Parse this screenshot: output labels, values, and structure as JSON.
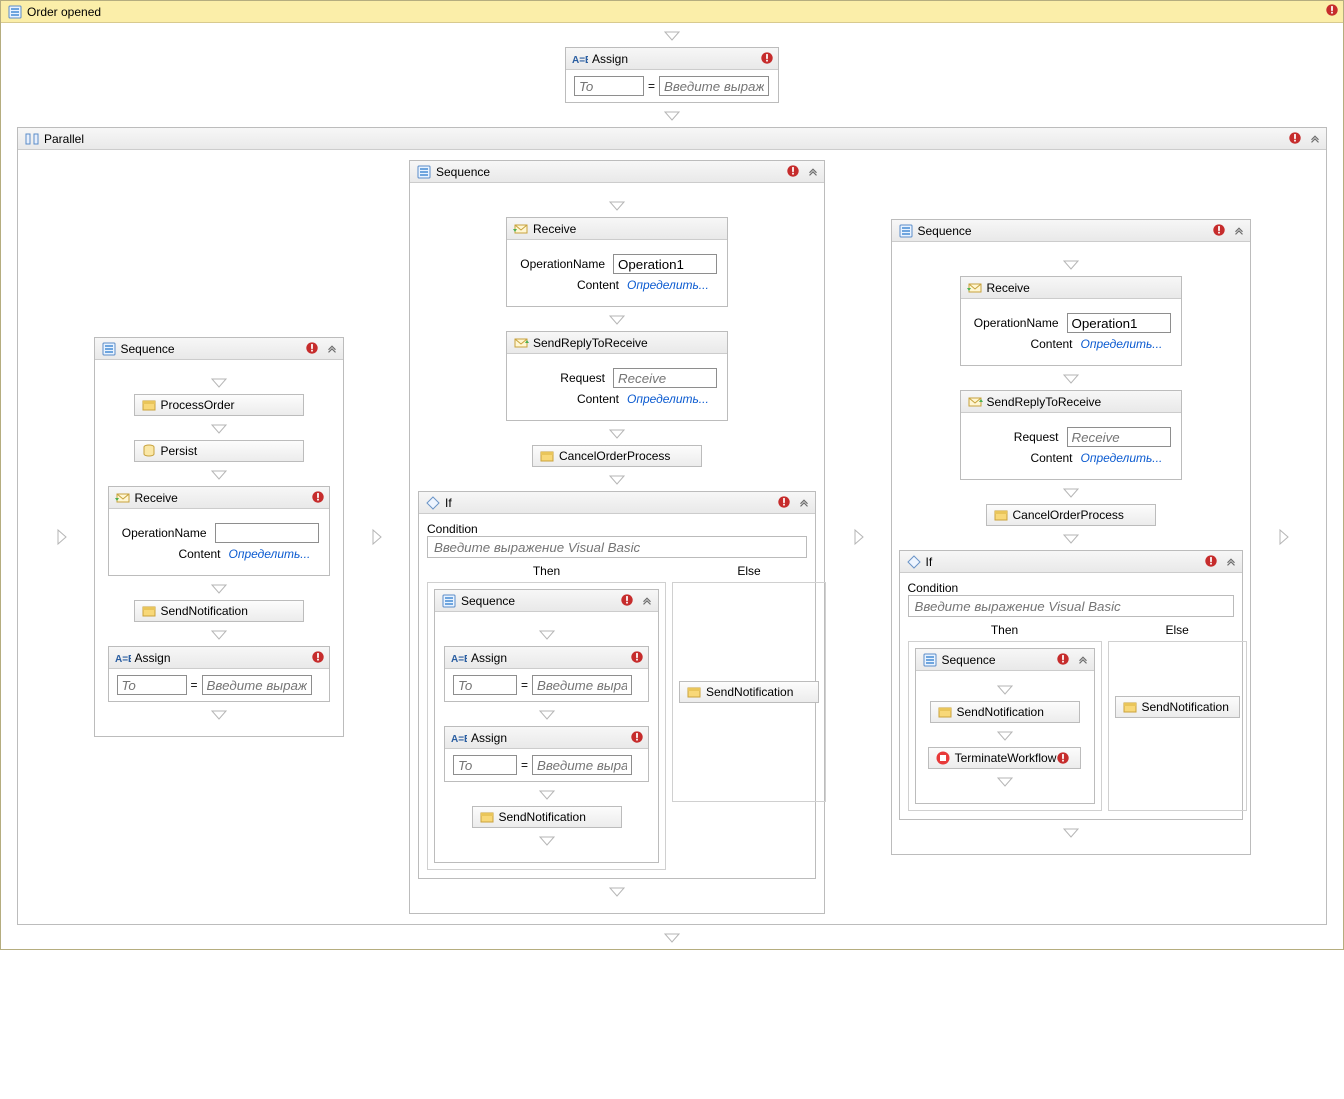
{
  "outer": {
    "title": "Order opened"
  },
  "assign": {
    "label": "Assign",
    "to_label": "To",
    "value_ph": "Введите выражени."
  },
  "parallel": {
    "label": "Parallel"
  },
  "sequence": {
    "label": "Sequence"
  },
  "activities": {
    "process_order": "ProcessOrder",
    "persist": "Persist",
    "receive": "Receive",
    "send_reply": "SendReplyToReceive",
    "cancel_order": "CancelOrderProcess",
    "send_notification": "SendNotification",
    "terminate": "TerminateWorkflow"
  },
  "receive": {
    "op_label": "OperationName",
    "op_value": "Operation1",
    "content_label": "Content",
    "content_link": "Определить..."
  },
  "reply": {
    "request_label": "Request",
    "request_value": "Receive",
    "content_label": "Content",
    "content_link": "Определить..."
  },
  "if": {
    "label": "If",
    "condition_label": "Condition",
    "condition_ph": "Введите выражение Visual Basic",
    "then": "Then",
    "else": "Else"
  }
}
